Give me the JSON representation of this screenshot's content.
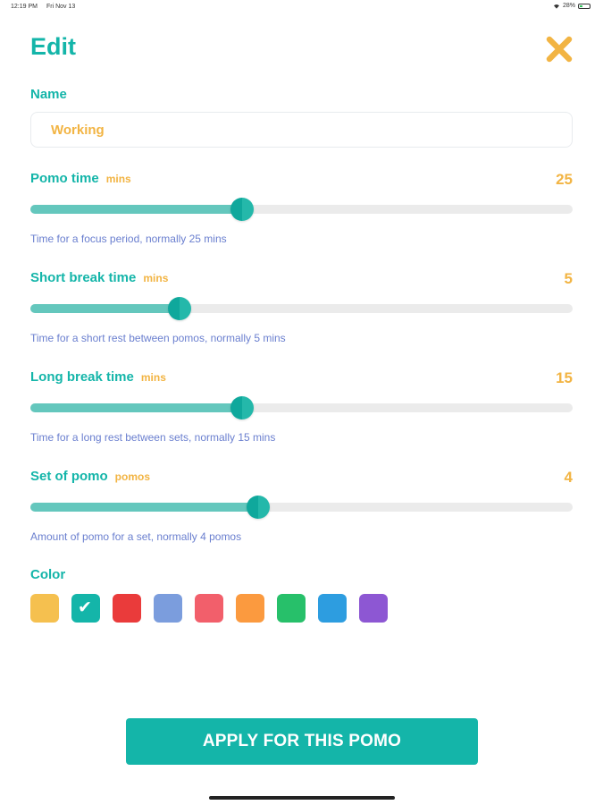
{
  "status_bar": {
    "time": "12:19 PM",
    "date": "Fri Nov 13",
    "battery_text": "28%",
    "battery_level": 0.28
  },
  "header": {
    "title": "Edit",
    "close_icon": "close-icon"
  },
  "name_field": {
    "label": "Name",
    "value": "Working"
  },
  "settings": [
    {
      "id": "pomo",
      "label": "Pomo time",
      "unit": "mins",
      "value": "25",
      "hint": "Time for a focus period, normally 25 mins",
      "level": 0.39
    },
    {
      "id": "short-break",
      "label": "Short break time",
      "unit": "mins",
      "value": "5",
      "hint": "Time for a short rest between pomos, normally 5 mins",
      "level": 0.275
    },
    {
      "id": "long-break",
      "label": "Long break time",
      "unit": "mins",
      "value": "15",
      "hint": "Time for a long rest between sets, normally 15 mins",
      "level": 0.39
    },
    {
      "id": "set",
      "label": "Set of pomo",
      "unit": "pomos",
      "value": "4",
      "hint": "Amount of pomo for a set, normally 4 pomos",
      "level": 0.42
    }
  ],
  "color_section": {
    "label": "Color",
    "swatches": [
      "#f5c04f",
      "#14b5a9",
      "#ea3b3b",
      "#7b9ddd",
      "#f25f6b",
      "#fb9a3f",
      "#27c06a",
      "#2d9de0",
      "#8d57d3"
    ],
    "selected_index": 1
  },
  "apply_button": {
    "label": "APPLY FOR THIS POMO"
  },
  "colors": {
    "accent": "#14b5a9",
    "value": "#f2b443",
    "hint": "#6a7fcf"
  }
}
